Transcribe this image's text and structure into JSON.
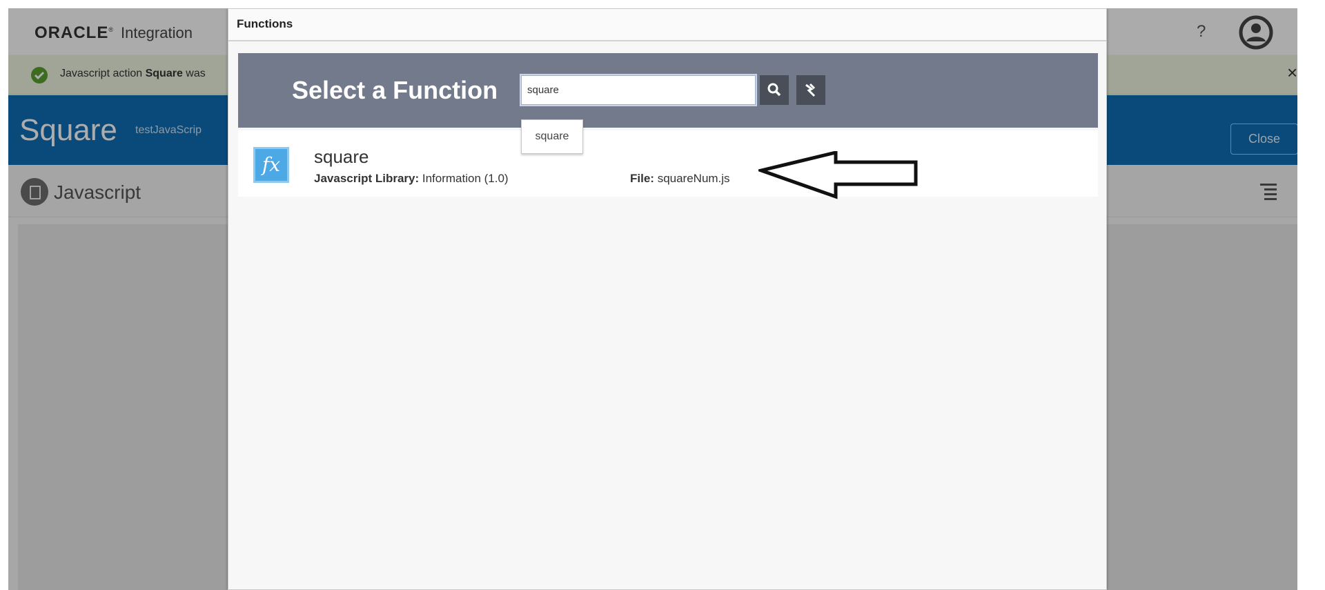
{
  "app": {
    "brand": "ORACLE",
    "product": "Integration",
    "help_label": "?",
    "avatar_icon": "user-icon"
  },
  "notification": {
    "text_prefix": "Javascript action ",
    "text_bold": "Square",
    "text_suffix": " was",
    "close_label": "×",
    "status_color": "#5a9e2f"
  },
  "titlebar": {
    "name": "Square",
    "subtitle": "testJavaScrip",
    "close_label": "Close",
    "color": "#0f6eb4"
  },
  "javascript_section": {
    "label": "Javascript",
    "menu_icon": "list-icon"
  },
  "dialog": {
    "title": "Functions",
    "heading": "Select a Function",
    "search_value": "square",
    "search_icon": "search-icon",
    "clear_icon": "clear-search-icon",
    "suggestion": "square",
    "result": {
      "name": "square",
      "library_label": "Javascript Library:",
      "library_value": "Information (1.0)",
      "file_label": "File:",
      "file_value": "squareNum.js",
      "icon": "fx-function-icon"
    }
  }
}
